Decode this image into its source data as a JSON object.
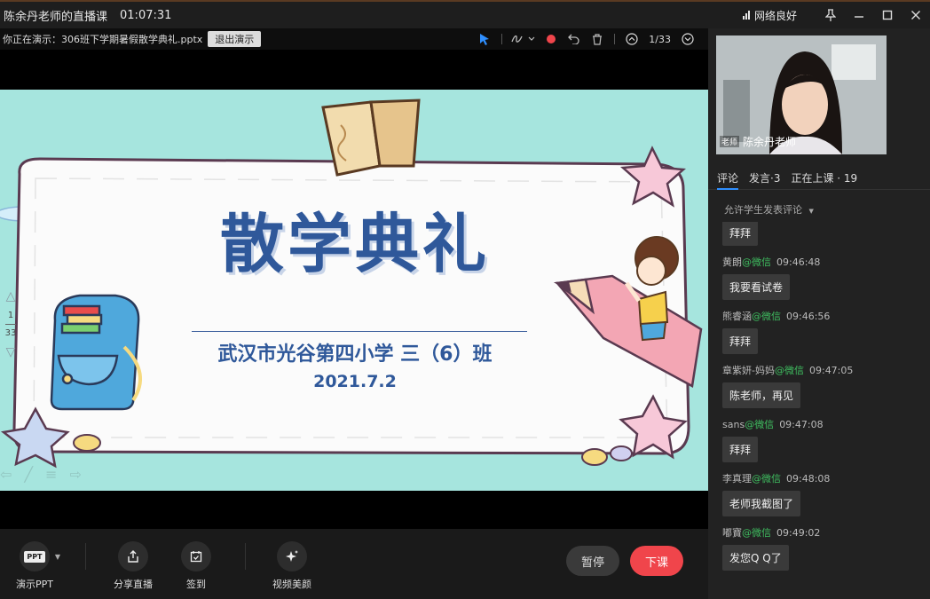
{
  "titlebar": {
    "title": "陈余丹老师的直播课",
    "timer": "01:07:31",
    "network": "网络良好",
    "pin_icon": "pin-icon",
    "minimize_icon": "minimize-icon",
    "maximize_icon": "maximize-icon",
    "close_icon": "close-icon"
  },
  "ppt_bar": {
    "presenting_label": "你正在演示：306班下学期暑假散学典礼.pptx",
    "exit_label": "退出演示",
    "page_indicator": "1/33"
  },
  "slide": {
    "title": "散学典礼",
    "school": "武汉市光谷第四小学 三（6）班",
    "date": "2021.7.2",
    "page_current": "1",
    "page_total": "33"
  },
  "bottombar": {
    "present_ppt": "演示PPT",
    "present_ppt_icon_text": "PPT",
    "share_live": "分享直播",
    "sign_in": "签到",
    "video_beauty": "视频美颜",
    "pause": "暂停",
    "end_class": "下课"
  },
  "right_panel": {
    "video_tag": "老师",
    "video_name": "陈余丹老师",
    "tabs": [
      {
        "label": "评论"
      },
      {
        "label": "发言·3"
      },
      {
        "label": "正在上课 · 19"
      }
    ],
    "allow_comments": "允许学生发表评论",
    "comments": [
      {
        "name": "",
        "via": "",
        "time": "",
        "text": "拜拜"
      },
      {
        "name": "黄朗",
        "via": "@微信",
        "time": "09:46:48",
        "text": "我要看试卷"
      },
      {
        "name": "熊睿涵",
        "via": "@微信",
        "time": "09:46:56",
        "text": "拜拜"
      },
      {
        "name": "章紫妍-妈妈",
        "via": "@微信",
        "time": "09:47:05",
        "text": "陈老师，再见"
      },
      {
        "name": "sans",
        "via": "@微信",
        "time": "09:47:08",
        "text": "拜拜"
      },
      {
        "name": "李真理",
        "via": "@微信",
        "time": "09:48:08",
        "text": "老师我截图了"
      },
      {
        "name": "嘟寶",
        "via": "@微信",
        "time": "09:49:02",
        "text": "发您Q Q了"
      }
    ]
  },
  "colors": {
    "accent_blue": "#2f8fff",
    "end_red": "#f0454b",
    "slide_bg": "#a6e5de",
    "slide_text": "#2f589a",
    "wechat_green": "#3fbf60"
  }
}
